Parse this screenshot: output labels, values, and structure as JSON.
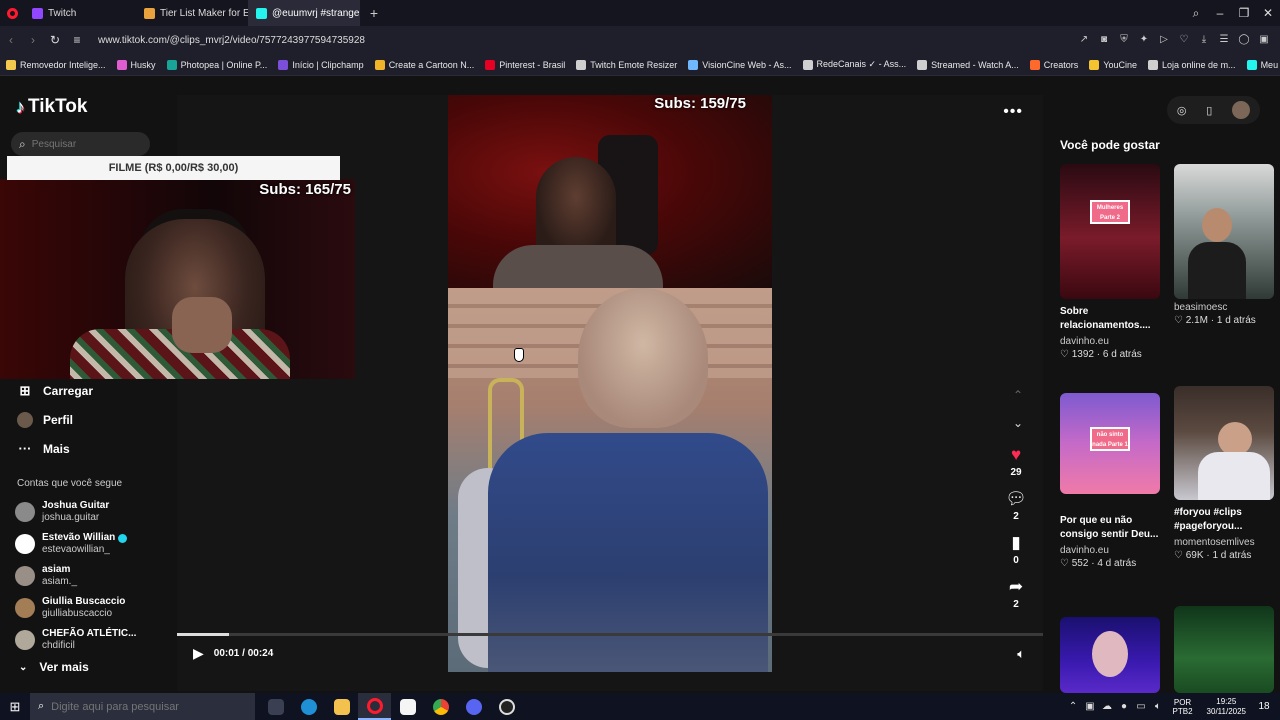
{
  "browser": {
    "tabs": [
      {
        "label": "Twitch",
        "color": "#9146ff",
        "active": false
      },
      {
        "label": "Tier List Maker for Everyth",
        "color": "#e8a33c",
        "active": false
      },
      {
        "label": "@euumvrj #strangert",
        "color": "#25f4ee",
        "active": true
      }
    ],
    "new_tab": "+",
    "url": "www.tiktok.com/@clips_mvrj2/video/7577243977594735928",
    "bookmarks": [
      {
        "label": "Removedor Intelige...",
        "color": "#f2c94c"
      },
      {
        "label": "Husky",
        "color": "#e05dd0"
      },
      {
        "label": "Photopea | Online P...",
        "color": "#18a497"
      },
      {
        "label": "Início | Clipchamp",
        "color": "#7b4fd9"
      },
      {
        "label": "Create a Cartoon N...",
        "color": "#f0b429"
      },
      {
        "label": "Pinterest - Brasil",
        "color": "#e60023"
      },
      {
        "label": "Twitch Emote Resizer",
        "color": "#cfcfcf"
      },
      {
        "label": "VisionCine Web - As...",
        "color": "#6fb8ff"
      },
      {
        "label": "RedeCanais ✓ - Ass...",
        "color": "#cfcfcf"
      },
      {
        "label": "Streamed - Watch A...",
        "color": "#cfcfcf"
      },
      {
        "label": "Creators",
        "color": "#ff6a2c"
      },
      {
        "label": "YouCine",
        "color": "#f4c430"
      },
      {
        "label": "Loja online de m...",
        "color": "#cfcfcf"
      },
      {
        "label": "Meu sonho de infân...",
        "color": "#25f4ee"
      }
    ]
  },
  "tiktok": {
    "logo": "TikTok",
    "search_placeholder": "Pesquisar",
    "menu": [
      {
        "label": "Carregar",
        "icon": "upload-icon"
      },
      {
        "label": "Perfil",
        "icon": "avatar"
      },
      {
        "label": "Mais",
        "icon": "more-icon"
      }
    ],
    "following_title": "Contas que você segue",
    "following": [
      {
        "name": "Joshua Guitar",
        "handle": "joshua.guitar",
        "color": "#8a8a8a",
        "verified": false
      },
      {
        "name": "Estevão Willian",
        "handle": "estevaowillian_",
        "color": "#ffffff",
        "verified": true
      },
      {
        "name": "asiam",
        "handle": "asiam._",
        "color": "#9a8f86",
        "verified": false
      },
      {
        "name": "Giullia Buscaccio",
        "handle": "giulliabuscaccio",
        "color": "#a37d55",
        "verified": false
      },
      {
        "name": "CHEFÃO ATLÉTIC...",
        "handle": "chdificil",
        "color": "#b0a89a",
        "verified": false
      }
    ],
    "see_more": "Ver mais"
  },
  "overlay": {
    "bar_text": "FILME (R$ 0,00/R$ 30,00)",
    "cam_subs": "Subs: 165/75"
  },
  "player": {
    "video_subs": "Subs: 159/75",
    "likes": "29",
    "comments": "2",
    "saves": "0",
    "shares": "2",
    "time": "00:01 / 00:24",
    "progress": 0.06,
    "author_peek": "clips_mvrj2"
  },
  "recommendations": {
    "title": "Você pode gostar",
    "items": [
      {
        "title": "Sobre relacionamentos....",
        "author": "davinho.eu",
        "likes": "1392",
        "age": "6 d atrás",
        "thumb_label": "Mulheres Parte 2"
      },
      {
        "title": "",
        "author": "beasimoesc",
        "likes": "2.1M",
        "age": "1 d atrás",
        "thumb_label": ""
      },
      {
        "title": "Por que eu não consigo sentir Deu...",
        "author": "davinho.eu",
        "likes": "552",
        "age": "4 d atrás",
        "thumb_label": "não sinto nada Parte 1"
      },
      {
        "title": "#foryou #clips #pageforyou...",
        "author": "momentosemlives",
        "likes": "69K",
        "age": "1 d atrás",
        "thumb_label": ""
      }
    ]
  },
  "taskbar": {
    "search_placeholder": "Digite aqui para pesquisar",
    "lang_top": "POR",
    "lang_bottom": "PTB2",
    "time": "19:25",
    "date": "30/11/2025",
    "notifications": "18"
  }
}
